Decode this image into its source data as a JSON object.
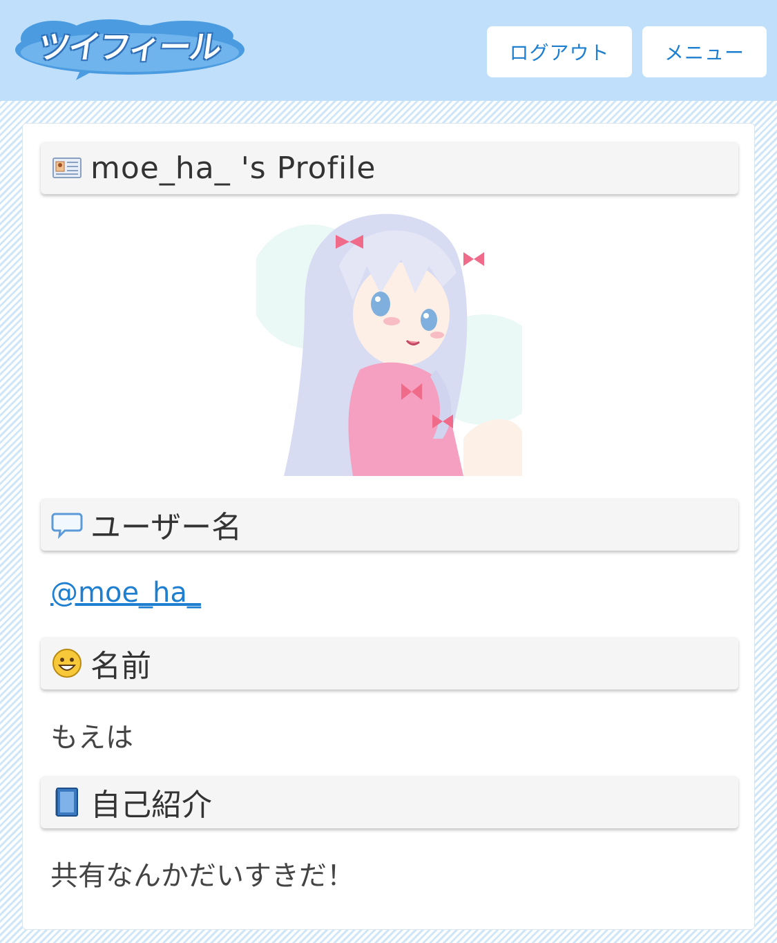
{
  "header": {
    "logo_text": "ツイフィール",
    "logout_label": "ログアウト",
    "menu_label": "メニュー"
  },
  "profile": {
    "username": "moe_ha_",
    "title_suffix": " 's Profile",
    "title": "moe_ha_ 's Profile"
  },
  "sections": {
    "username_heading": "ユーザー名",
    "username_value": "@moe_ha_",
    "name_heading": "名前",
    "name_value": "もえは",
    "bio_heading": "自己紹介",
    "bio_value": "共有なんかだいすきだ！"
  },
  "colors": {
    "header_bg": "#bfdffb",
    "accent": "#1e7fd0"
  },
  "icons": [
    "id-card-icon",
    "speech-bubble-icon",
    "smiley-icon",
    "book-icon"
  ]
}
